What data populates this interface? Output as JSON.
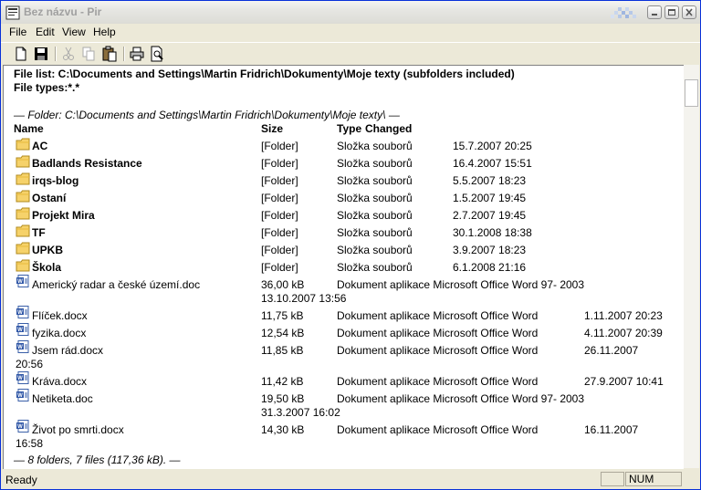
{
  "window": {
    "title": "Bez názvu - Pir"
  },
  "menu": [
    "File",
    "Edit",
    "View",
    "Help"
  ],
  "toolbar": [
    "new-icon",
    "save-icon",
    "cut-icon",
    "copy-icon",
    "paste-icon",
    "print-icon",
    "print-preview-icon"
  ],
  "header": {
    "file_list": "File list: C:\\Documents and Settings\\Martin Fridrich\\Dokumenty\\Moje texty (subfolders included)",
    "file_types": "File types:*.*"
  },
  "folder_line": "— Folder: C:\\Documents and Settings\\Martin Fridrich\\Dokumenty\\Moje texty\\ —",
  "columns": {
    "name": "Name",
    "size": "Size",
    "type": "Type",
    "changed": "Changed"
  },
  "folders": [
    {
      "name": "AC",
      "size": "[Folder]",
      "type": "Složka souborů",
      "changed": "15.7.2007 20:25"
    },
    {
      "name": "Badlands Resistance",
      "size": "[Folder]",
      "type": "Složka souborů",
      "changed": "16.4.2007 15:51"
    },
    {
      "name": "irqs-blog",
      "size": "[Folder]",
      "type": "Složka souborů",
      "changed": "5.5.2007 18:23"
    },
    {
      "name": "Ostaní",
      "size": "[Folder]",
      "type": "Složka souborů",
      "changed": "1.5.2007 19:45"
    },
    {
      "name": "Projekt Mira",
      "size": "[Folder]",
      "type": "Složka souborů",
      "changed": "2.7.2007 19:45"
    },
    {
      "name": "TF",
      "size": "[Folder]",
      "type": "Složka souborů",
      "changed": "30.1.2008 18:38"
    },
    {
      "name": "UPKB",
      "size": "[Folder]",
      "type": "Složka souborů",
      "changed": "3.9.2007 18:23"
    },
    {
      "name": "Škola",
      "size": "[Folder]",
      "type": "Složka souborů",
      "changed": "6.1.2008 21:16"
    }
  ],
  "files": [
    {
      "name": "Americký radar a české území.doc",
      "size": "36,00 kB",
      "type": "Dokument aplikace Microsoft Office Word 97- 2003",
      "changed": "",
      "wrap": "13.10.2007 13:56",
      "wrap_indent": true
    },
    {
      "name": "Flíček.docx",
      "size": "11,75 kB",
      "type": "Dokument aplikace Microsoft Office Word",
      "changed": "1.11.2007 20:23",
      "wrap": ""
    },
    {
      "name": "fyzika.docx",
      "size": "12,54 kB",
      "type": "Dokument aplikace Microsoft Office Word",
      "changed": "4.11.2007 20:39",
      "wrap": ""
    },
    {
      "name": "Jsem rád.docx",
      "size": "11,85 kB",
      "type": "Dokument aplikace Microsoft Office Word",
      "changed": "26.11.2007",
      "wrap": "20:56",
      "wrap_indent": false
    },
    {
      "name": "Kráva.docx",
      "size": "11,42 kB",
      "type": "Dokument aplikace Microsoft Office Word",
      "changed": "27.9.2007 10:41",
      "wrap": ""
    },
    {
      "name": "Netiketa.doc",
      "size": "19,50 kB",
      "type": "Dokument aplikace Microsoft Office Word 97- 2003",
      "changed": "",
      "wrap": "31.3.2007 16:02",
      "wrap_indent": true
    },
    {
      "name": "Život po smrti.docx",
      "size": "14,30 kB",
      "type": "Dokument aplikace Microsoft Office Word",
      "changed": "16.11.2007",
      "wrap": "16:58",
      "wrap_indent": false
    }
  ],
  "summary": "— 8 folders, 7 files (117,36 kB). —",
  "status": {
    "text": "Ready",
    "num": "NUM"
  }
}
